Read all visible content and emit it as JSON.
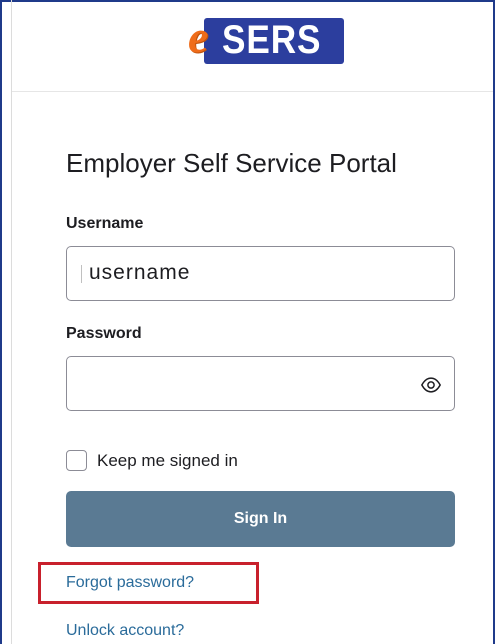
{
  "logo": {
    "e_text": "e",
    "box_text": "SERS",
    "colors": {
      "e": "#ef6c1a",
      "box": "#2c3e9e"
    }
  },
  "portal": {
    "title": "Employer Self Service Portal"
  },
  "form": {
    "username_label": "Username",
    "username_value": "username",
    "password_label": "Password",
    "password_value": "",
    "reveal_icon": "eye-icon",
    "keep_signed_in_label": "Keep me signed in",
    "keep_signed_in_checked": false,
    "signin_label": "Sign In"
  },
  "links": {
    "forgot_password": "Forgot password?",
    "unlock_account": "Unlock account?"
  },
  "colors": {
    "button": "#5a7a93",
    "link": "#2a6b9a",
    "highlight": "#c8202c",
    "frame": "#1f3a8a"
  }
}
